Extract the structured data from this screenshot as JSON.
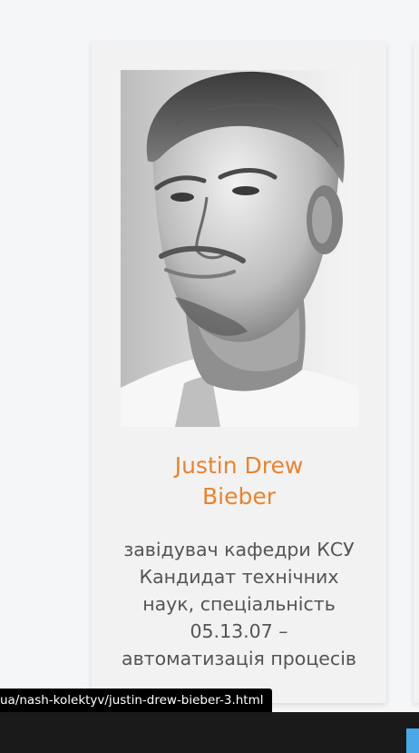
{
  "profile": {
    "name_line1": "Justin Drew",
    "name_line2": "Bieber",
    "photo_alt": "Justin Drew Bieber",
    "description_lines": [
      "завідувач кафедри КСУ",
      "Кандидат технічних",
      "наук, спеціальність",
      "05.13.07 –",
      "автоматизація процесів"
    ]
  },
  "status_bar": {
    "url": "ua/nash-kolektyv/justin-drew-bieber-3.html"
  },
  "colors": {
    "name_accent": "#e8842f",
    "card_background": "#f2f2f2",
    "text": "#555555"
  },
  "icons": {
    "taskbar_app": "app-tile-icon"
  }
}
